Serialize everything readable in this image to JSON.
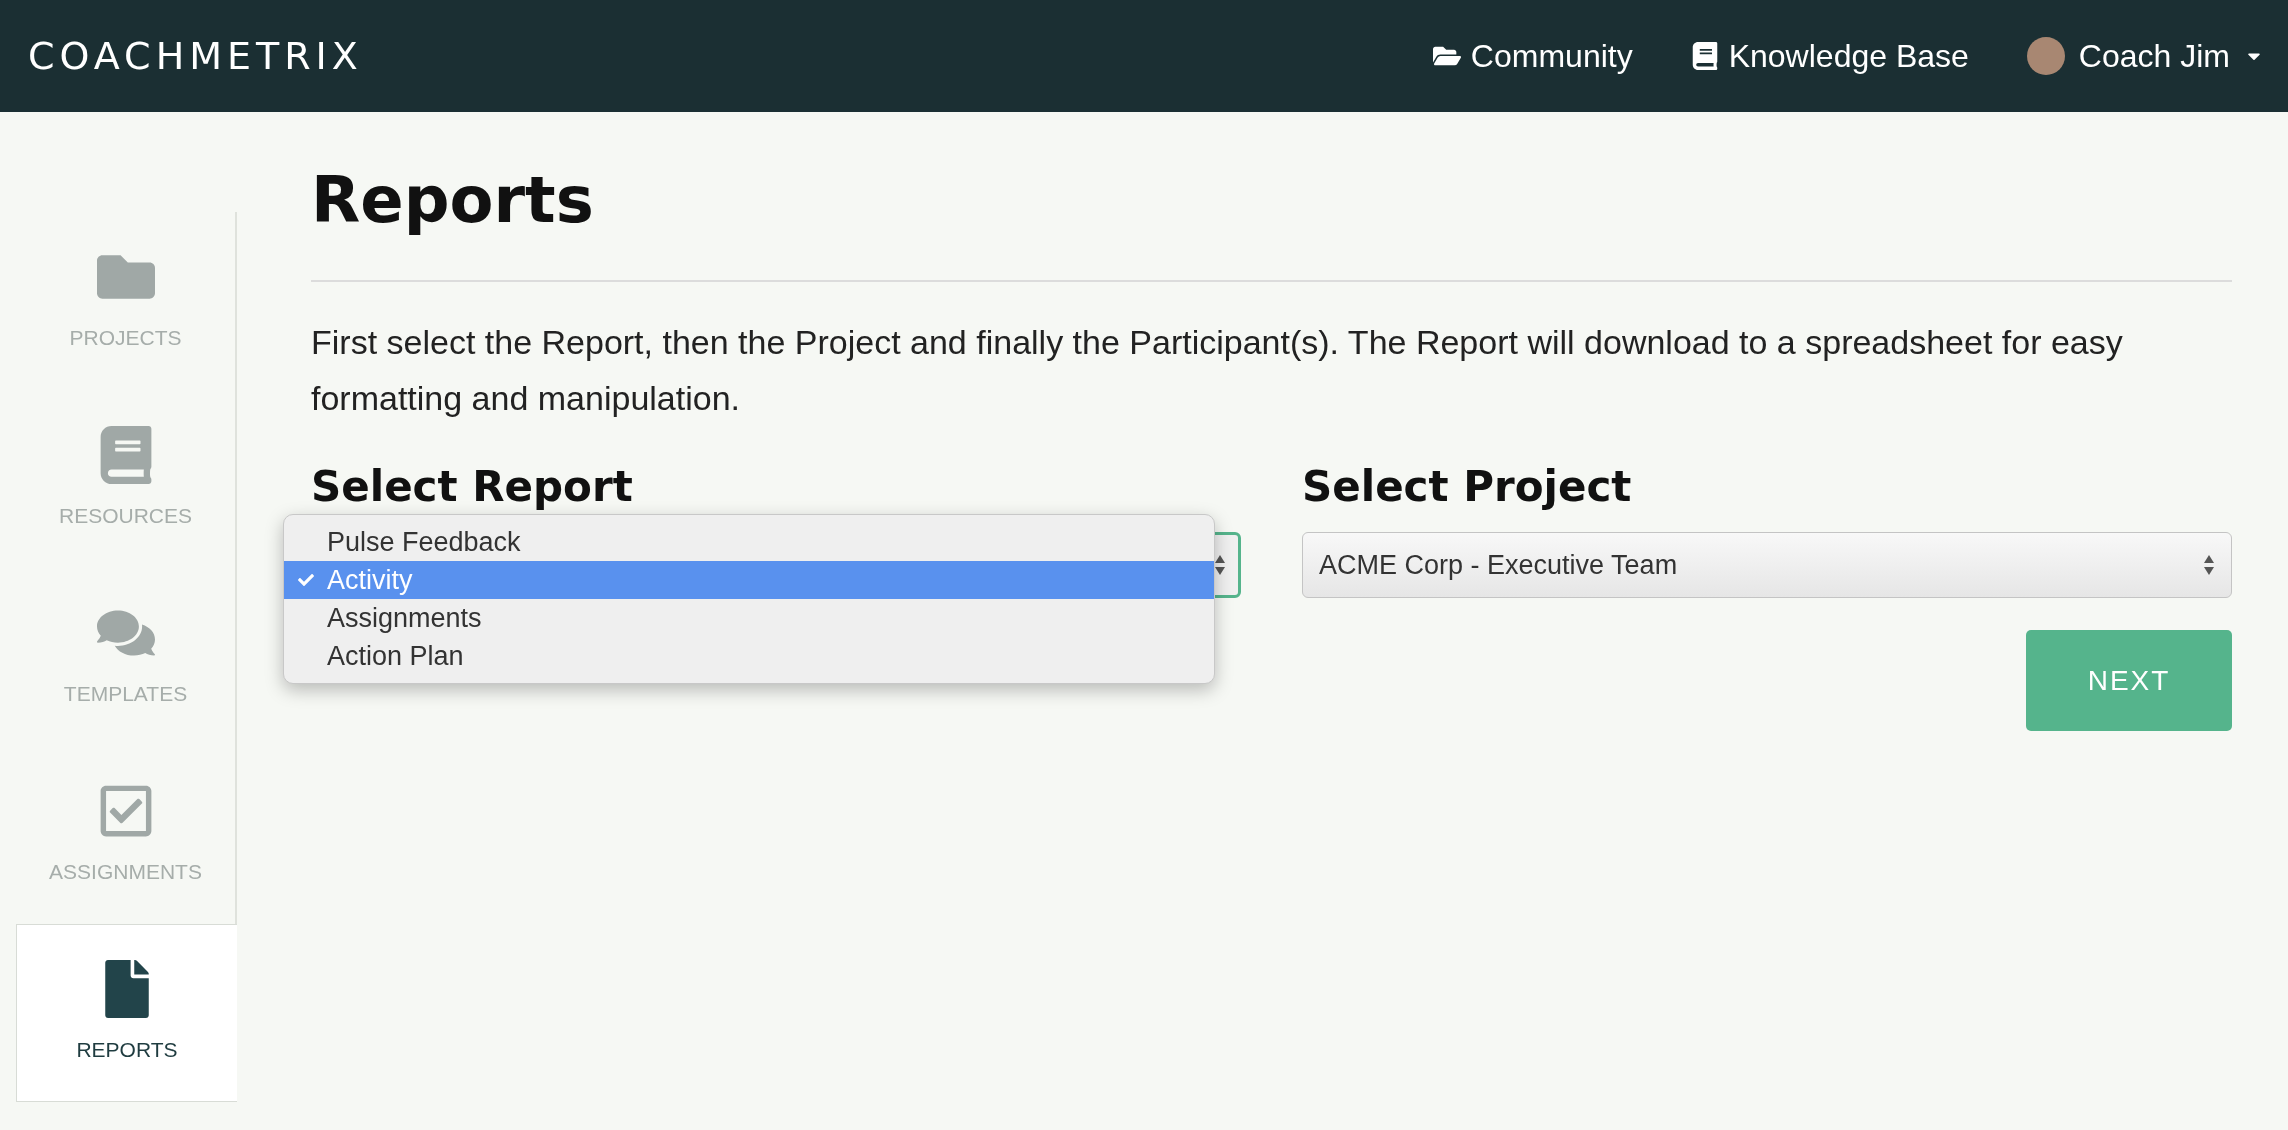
{
  "header": {
    "logo": "COACHMETRIX",
    "links": [
      {
        "kind": "folder",
        "label": "Community"
      },
      {
        "kind": "book",
        "label": "Knowledge Base"
      }
    ],
    "user": {
      "name": "Coach Jim"
    }
  },
  "sidebar": {
    "items": [
      {
        "kind": "folder",
        "label": "PROJECTS",
        "selected": false
      },
      {
        "kind": "book",
        "label": "RESOURCES",
        "selected": false
      },
      {
        "kind": "comments",
        "label": "TEMPLATES",
        "selected": false
      },
      {
        "kind": "check",
        "label": "ASSIGNMENTS",
        "selected": false
      },
      {
        "kind": "file",
        "label": "REPORTS",
        "selected": true
      }
    ]
  },
  "page": {
    "title": "Reports",
    "intro": "First select the Report, then the Project and finally the Participant(s). The Report will download to a spreadsheet for easy formatting and manipulation.",
    "report": {
      "label": "Select Report",
      "options": [
        {
          "label": "Pulse Feedback",
          "selected": false
        },
        {
          "label": "Activity",
          "selected": true
        },
        {
          "label": "Assignments",
          "selected": false
        },
        {
          "label": "Action Plan",
          "selected": false
        }
      ]
    },
    "project": {
      "label": "Select Project",
      "value": "ACME Corp - Executive Team"
    },
    "next_button": "NEXT"
  }
}
